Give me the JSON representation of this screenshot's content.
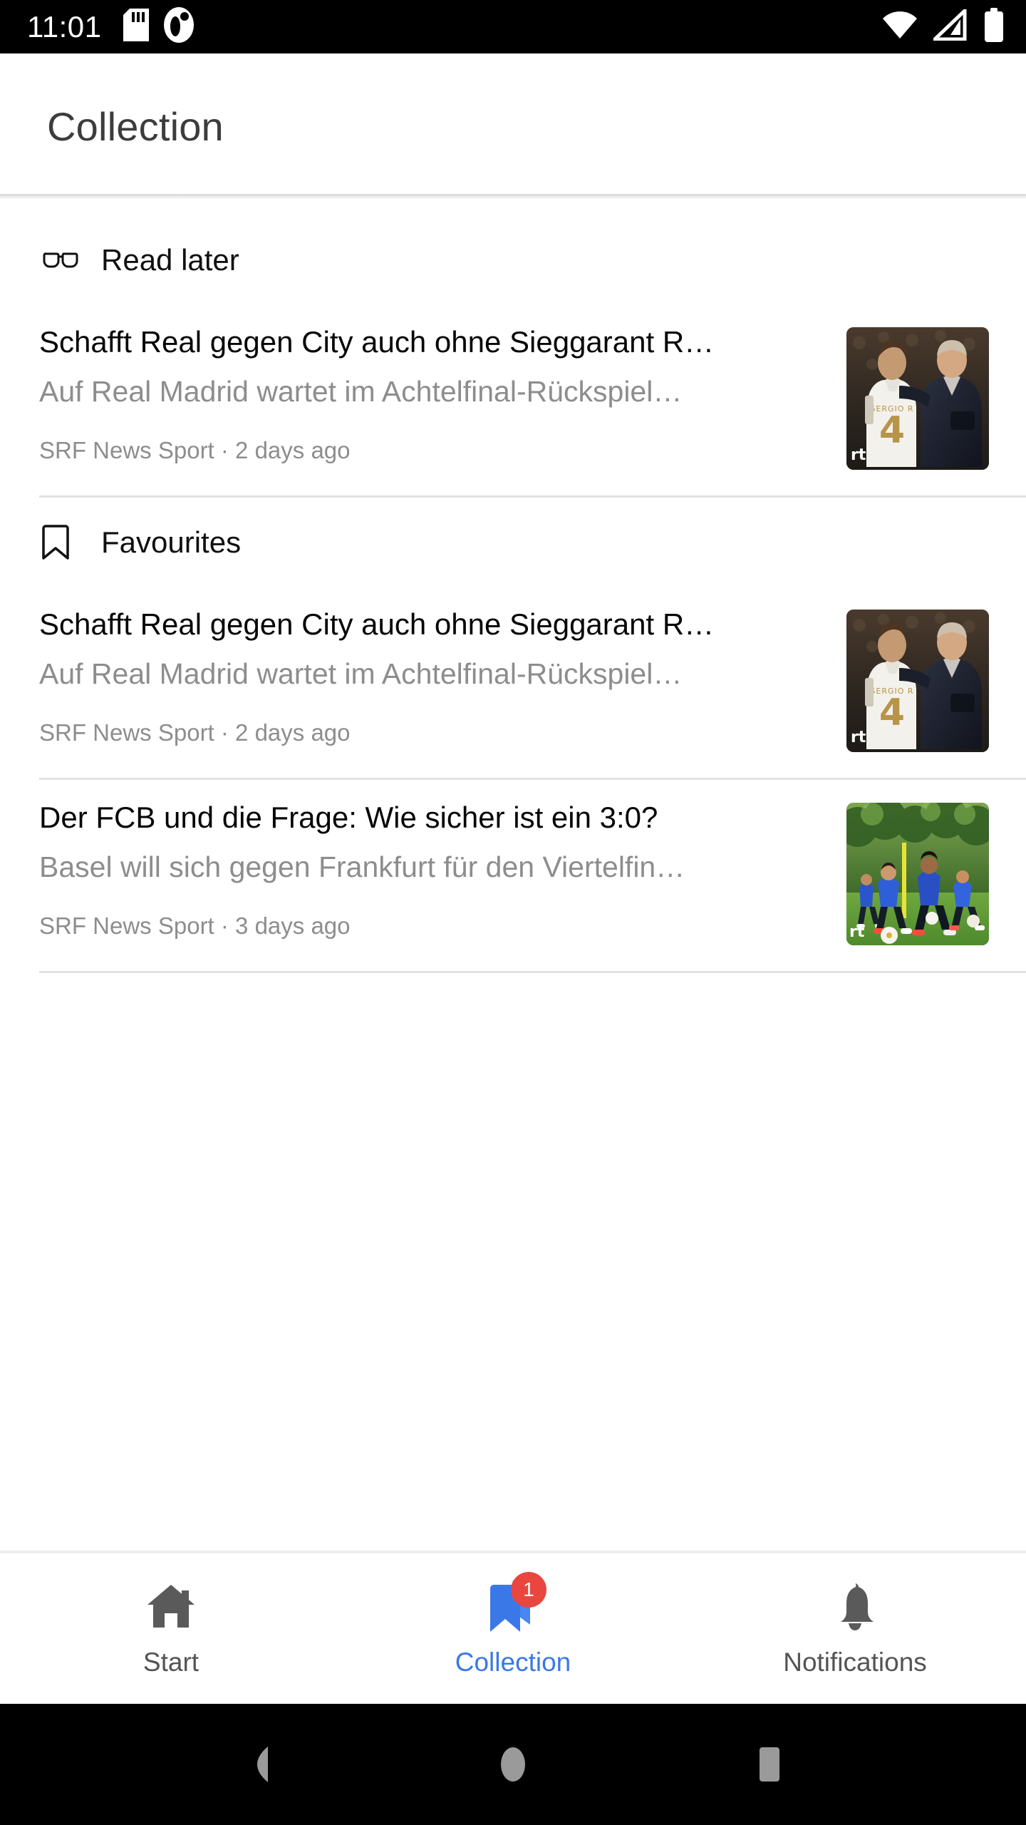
{
  "status_bar": {
    "time": "11:01",
    "left_icons": [
      "sd-card-icon",
      "app-notification-icon"
    ],
    "right_icons": [
      "wifi-icon",
      "cellular-signal-icon",
      "battery-icon"
    ]
  },
  "header": {
    "title": "Collection"
  },
  "sections": [
    {
      "icon": "glasses-icon",
      "label": "Read later",
      "articles": [
        {
          "title": "Schafft Real gegen City auch ohne Sieggarant R…",
          "summary": "Auf Real Madrid wartet im Achtelfinal-Rückspiel…",
          "source": "SRF News Sport",
          "separator": "·",
          "time": "2 days ago",
          "meta": "SRF News Sport · 2 days ago",
          "thumbnail": "real-madrid-player-coach-photo"
        }
      ]
    },
    {
      "icon": "bookmark-outline-icon",
      "label": "Favourites",
      "articles": [
        {
          "title": "Schafft Real gegen City auch ohne Sieggarant R…",
          "summary": "Auf Real Madrid wartet im Achtelfinal-Rückspiel…",
          "source": "SRF News Sport",
          "separator": "·",
          "time": "2 days ago",
          "meta": "SRF News Sport · 2 days ago",
          "thumbnail": "real-madrid-player-coach-photo"
        },
        {
          "title": "Der FCB und die Frage: Wie sicher ist ein 3:0?",
          "summary": "Basel will sich gegen Frankfurt für den Viertelfin…",
          "source": "SRF News Sport",
          "separator": "·",
          "time": "3 days ago",
          "meta": "SRF News Sport · 3 days ago",
          "thumbnail": "football-team-training-photo"
        }
      ]
    }
  ],
  "bottom_nav": {
    "items": [
      {
        "label": "Start",
        "icon": "home-icon",
        "active": false,
        "badge": null
      },
      {
        "label": "Collection",
        "icon": "bookmarks-icon",
        "active": true,
        "badge": "1"
      },
      {
        "label": "Notifications",
        "icon": "bell-icon",
        "active": false,
        "badge": null
      }
    ]
  },
  "android_nav": {
    "buttons": [
      "back-icon",
      "home-circle-icon",
      "recents-square-icon"
    ]
  },
  "colors": {
    "accent": "#3b78e7",
    "badge": "#e8463f",
    "title": "#3c3c3c",
    "body": "#050505",
    "muted": "#8d8d8d",
    "divider": "#e2e2e2"
  }
}
